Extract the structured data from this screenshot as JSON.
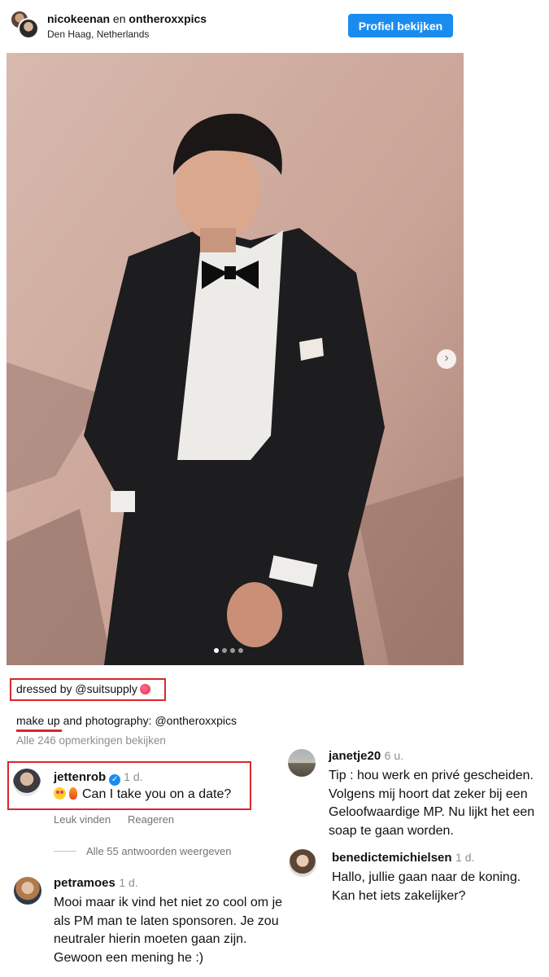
{
  "header": {
    "user1": "nicokeenan",
    "joiner": "en",
    "user2": "ontheroxxpics",
    "location": "Den Haag, Netherlands",
    "profile_button": "Profiel bekijken"
  },
  "post": {
    "caption_line1": "dressed by @suitsupply",
    "caption_line2": "make up and photography: @ontheroxxpics",
    "all_comments": "Alle 246 opmerkingen bekijken",
    "carousel_dots": 4,
    "carousel_active": 1
  },
  "comments": {
    "jetten": {
      "user": "jettenrob",
      "time": "1 d.",
      "text": "Can I take you on a date?",
      "like": "Leuk vinden",
      "reply": "Reageren",
      "view_replies": "Alle 55 antwoorden weergeven"
    },
    "petra": {
      "user": "petramoes",
      "time": "1 d.",
      "text": "Mooi maar ik vind het niet zo cool om je als PM man te laten sponsoren. Je zou neutraler hierin moeten gaan zijn. Gewoon een mening he :)"
    },
    "janet": {
      "user": "janetje20",
      "time": "6 u.",
      "text": "Tip : hou werk en privé gescheiden. Volgens mij hoort dat zeker bij een Geloofwaardige MP. Nu lijkt het een soap te gaan worden."
    },
    "bene": {
      "user": "benedictemichielsen",
      "time": "1 d.",
      "text": "Hallo, jullie gaan naar de koning. Kan het iets zakelijker?"
    }
  },
  "colors": {
    "accent": "#1a8cf0",
    "highlight": "#d9262c",
    "muted": "#8e8e8e"
  }
}
